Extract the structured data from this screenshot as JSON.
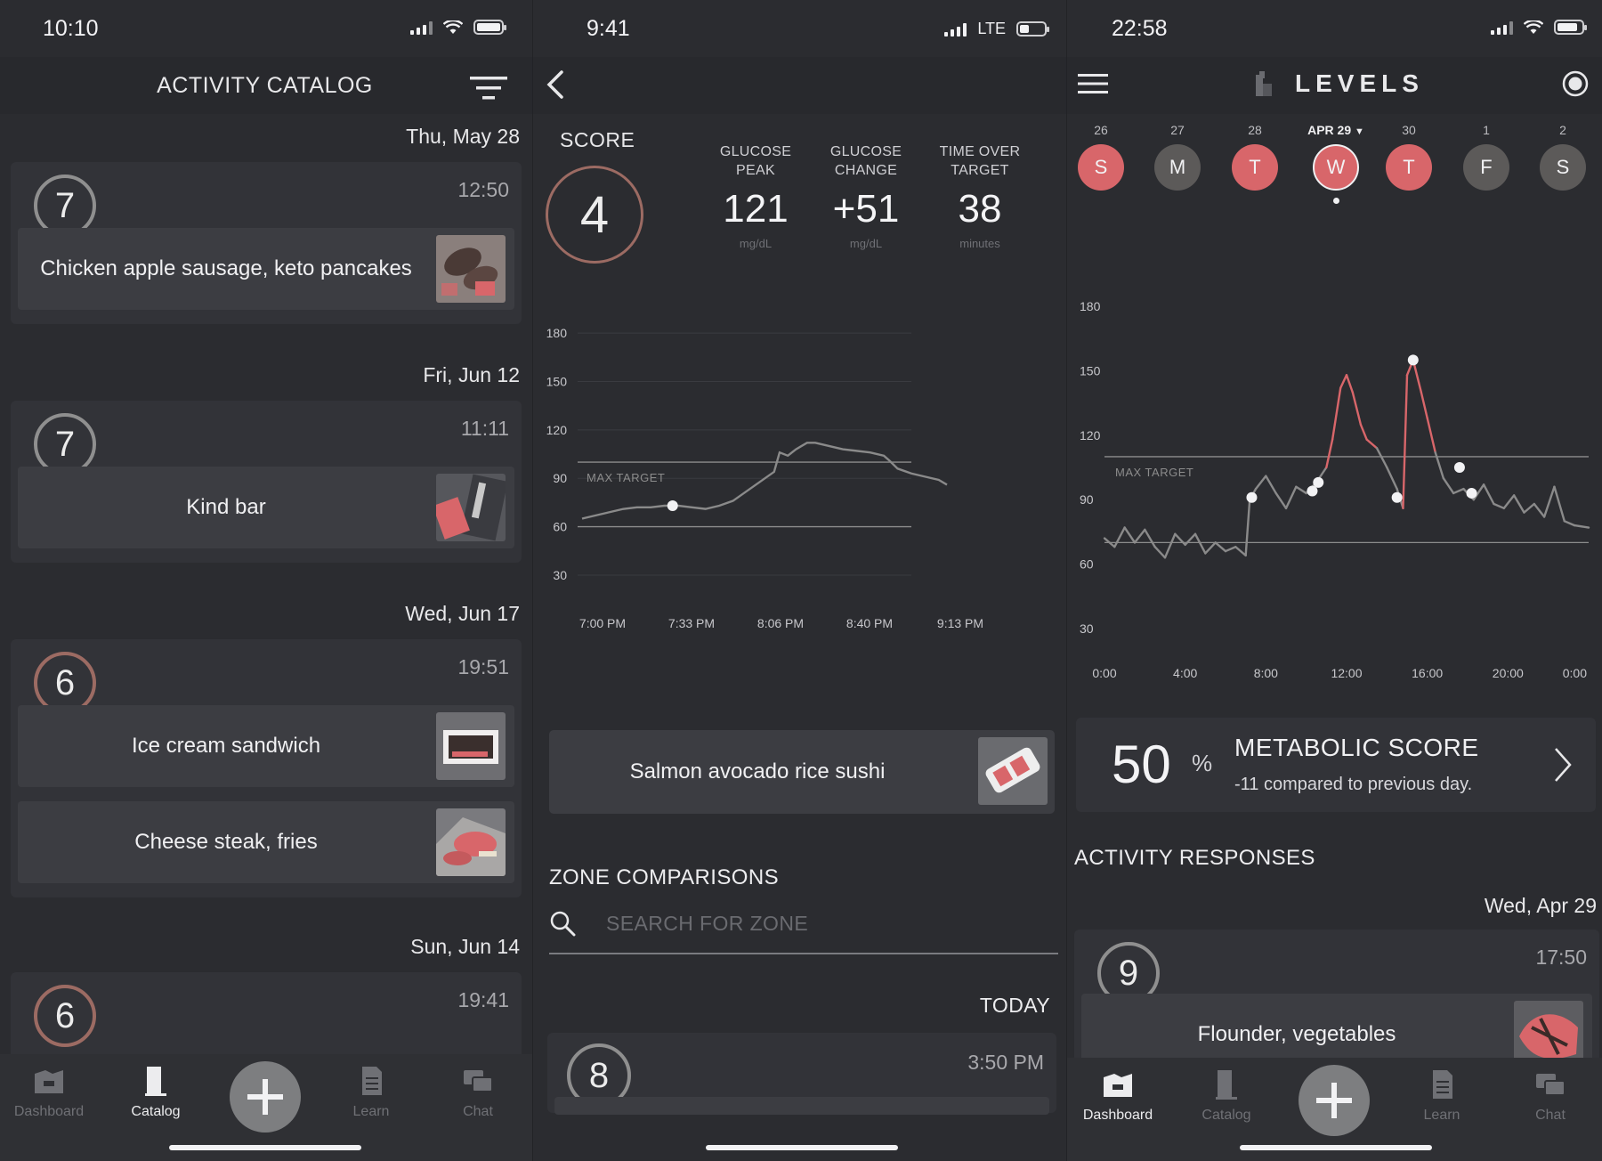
{
  "colors": {
    "background": "#2b2c30",
    "card": "#323338",
    "row": "#3c3d42",
    "accent_red": "#d8666a",
    "muted_gray": "#5c5a59",
    "line_gray": "#8c8c8c"
  },
  "panel1": {
    "status_time": "10:10",
    "title": "ACTIVITY CATALOG",
    "groups": [
      {
        "date": "Thu, May 28",
        "score": "7",
        "time": "12:50",
        "foods": [
          "Chicken apple sausage, keto pancakes"
        ]
      },
      {
        "date": "Fri, Jun 12",
        "score": "7",
        "time": "11:11",
        "foods": [
          "Kind bar"
        ]
      },
      {
        "date": "Wed, Jun 17",
        "score": "6",
        "time": "19:51",
        "foods": [
          "Ice cream sandwich",
          "Cheese steak, fries"
        ]
      },
      {
        "date": "Sun, Jun 14",
        "score": "6",
        "time": "19:41",
        "foods": []
      }
    ],
    "tabs": [
      "Dashboard",
      "Catalog",
      "Learn",
      "Chat"
    ],
    "active_tab": "Catalog"
  },
  "panel2": {
    "status_time": "9:41",
    "network": "LTE",
    "score_label": "SCORE",
    "score": "4",
    "stats": [
      {
        "label_line1": "GLUCOSE",
        "label_line2": "PEAK",
        "value": "121",
        "unit": "mg/dL"
      },
      {
        "label_line1": "GLUCOSE",
        "label_line2": "CHANGE",
        "value": "+51",
        "unit": "mg/dL"
      },
      {
        "label_line1": "TIME OVER",
        "label_line2": "TARGET",
        "value": "38",
        "unit": "minutes"
      }
    ],
    "food": "Salmon avocado rice sushi",
    "zone_title": "ZONE COMPARISONS",
    "search_placeholder": "SEARCH FOR ZONE",
    "today_label": "TODAY",
    "today_score": "8",
    "today_time": "3:50 PM"
  },
  "panel3": {
    "status_time": "22:58",
    "brand": "LEVELS",
    "days": [
      {
        "num": "26",
        "letter": "S",
        "tone": "red"
      },
      {
        "num": "27",
        "letter": "M",
        "tone": "gray"
      },
      {
        "num": "28",
        "letter": "T",
        "tone": "red"
      },
      {
        "num": "APR 29",
        "letter": "W",
        "tone": "red",
        "selected": true
      },
      {
        "num": "30",
        "letter": "T",
        "tone": "red"
      },
      {
        "num": "1",
        "letter": "F",
        "tone": "gray"
      },
      {
        "num": "2",
        "letter": "S",
        "tone": "gray"
      }
    ],
    "metabolic": {
      "value": "50",
      "unit": "%",
      "title": "METABOLIC SCORE",
      "subtitle": "-11 compared to previous day."
    },
    "activity_title": "ACTIVITY RESPONSES",
    "activity_date": "Wed, Apr 29",
    "activity_score": "9",
    "activity_time": "17:50",
    "activity_food": "Flounder, vegetables",
    "tabs": [
      "Dashboard",
      "Catalog",
      "Learn",
      "Chat"
    ],
    "active_tab": "Dashboard"
  },
  "chart_data": [
    {
      "type": "line",
      "x_ticks": [
        "7:00 PM",
        "7:33 PM",
        "8:06 PM",
        "8:40 PM",
        "9:13 PM"
      ],
      "y_ticks": [
        180,
        150,
        120,
        90,
        60,
        30
      ],
      "ylim": [
        25,
        185
      ],
      "target_label": "MAX TARGET",
      "max_target": 100,
      "min_target": 60,
      "x_minutes": [
        0,
        5,
        10,
        15,
        20,
        25,
        30,
        35,
        40,
        45,
        50,
        55,
        60,
        65,
        70,
        72,
        75,
        78,
        80,
        82,
        85,
        90,
        95,
        100,
        105,
        110,
        112,
        115,
        120,
        125,
        130,
        133
      ],
      "values": [
        65,
        67,
        69,
        71,
        72,
        72,
        73,
        73,
        72,
        71,
        73,
        76,
        82,
        88,
        94,
        106,
        104,
        108,
        110,
        112,
        112,
        110,
        108,
        107,
        106,
        104,
        101,
        96,
        93,
        91,
        89,
        86
      ],
      "marker": {
        "x_minute": 33,
        "value": 73
      }
    },
    {
      "type": "line",
      "x_ticks": [
        "0:00",
        "4:00",
        "8:00",
        "12:00",
        "16:00",
        "20:00",
        "0:00"
      ],
      "y_ticks": [
        180,
        150,
        120,
        90,
        60,
        30
      ],
      "ylim": [
        20,
        190
      ],
      "target_label": "MAX TARGET",
      "max_target": 110,
      "min_target": 70,
      "x_hours": [
        0,
        0.5,
        1,
        1.5,
        2,
        2.5,
        3,
        3.5,
        4,
        4.5,
        5,
        5.5,
        6,
        6.5,
        7,
        7.2,
        7.5,
        8,
        8.5,
        9,
        9.5,
        10,
        10.5,
        11,
        11.3,
        11.7,
        12,
        12.3,
        12.7,
        13,
        13.5,
        14,
        14.5,
        14.8,
        15,
        15.3,
        15.7,
        16,
        16.4,
        16.8,
        17.3,
        17.8,
        18.3,
        18.8,
        19.3,
        19.8,
        20.3,
        20.8,
        21.3,
        21.8,
        22.3,
        22.8,
        23.3,
        24
      ],
      "values": [
        72,
        68,
        77,
        70,
        76,
        68,
        63,
        74,
        69,
        74,
        65,
        70,
        66,
        68,
        64,
        90,
        95,
        101,
        93,
        86,
        96,
        93,
        98,
        105,
        118,
        142,
        148,
        140,
        125,
        118,
        114,
        105,
        95,
        86,
        148,
        155,
        140,
        128,
        112,
        100,
        93,
        95,
        90,
        97,
        88,
        86,
        92,
        84,
        88,
        82,
        96,
        80,
        78,
        77
      ],
      "markers": [
        {
          "x_hour": 7.3,
          "value": 91
        },
        {
          "x_hour": 10.3,
          "value": 94
        },
        {
          "x_hour": 10.6,
          "value": 98
        },
        {
          "x_hour": 14.5,
          "value": 91
        },
        {
          "x_hour": 15.3,
          "value": 155
        },
        {
          "x_hour": 17.6,
          "value": 105
        },
        {
          "x_hour": 18.2,
          "value": 93
        }
      ]
    }
  ]
}
